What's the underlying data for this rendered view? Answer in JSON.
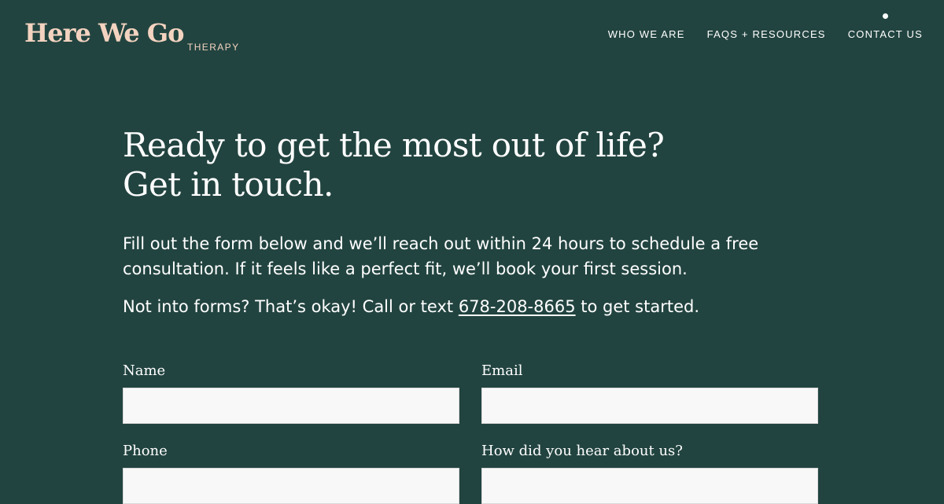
{
  "brand": {
    "name": "Here We Go",
    "subtitle": "THERAPY"
  },
  "nav": {
    "items": [
      {
        "label": "WHO WE ARE",
        "active": false
      },
      {
        "label": "FAQS + RESOURCES",
        "active": false
      },
      {
        "label": "CONTACT US",
        "active": true
      }
    ]
  },
  "hero": {
    "headline_line1": "Ready to get the most out of life?",
    "headline_line2": "Get in touch.",
    "paragraph1": "Fill out the form below and we’ll reach out within 24 hours to schedule a free consultation. If it feels like a perfect fit, we’ll book your first session.",
    "paragraph2_before": "Not into forms? That’s okay! Call or text ",
    "phone": "678-208-8665",
    "paragraph2_after": " to get started."
  },
  "form": {
    "name": {
      "label": "Name",
      "value": "",
      "placeholder": ""
    },
    "email": {
      "label": "Email",
      "value": "",
      "placeholder": ""
    },
    "phone": {
      "label": "Phone",
      "value": "",
      "placeholder": ""
    },
    "heard": {
      "label": "How did you hear about us?",
      "value": "",
      "placeholder": ""
    }
  },
  "colors": {
    "background": "#224440",
    "brand_accent": "#f3d3c0",
    "text": "#ffffff",
    "input_bg": "#f8f8f8"
  }
}
